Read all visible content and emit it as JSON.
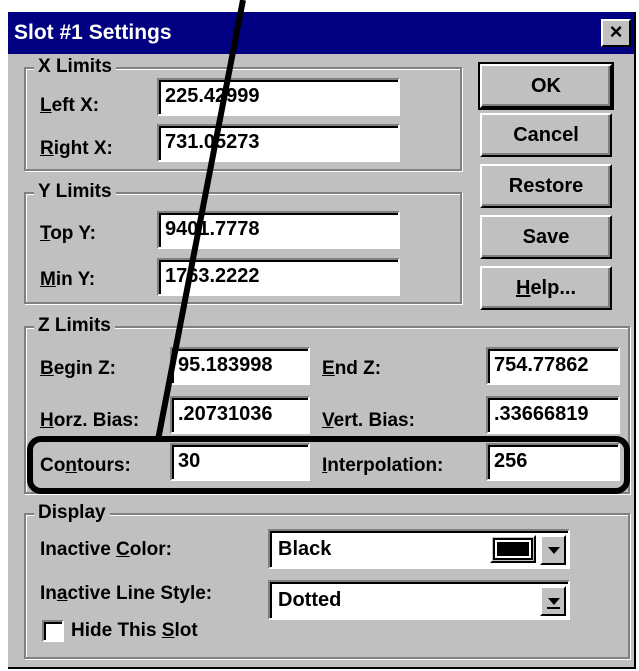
{
  "dialog": {
    "title": "Slot #1 Settings",
    "close_glyph": "×"
  },
  "x_limits": {
    "legend": "X Limits",
    "left_label_key": "L",
    "left_label_rest": "eft X:",
    "left_value": "225.42999",
    "right_label_key": "R",
    "right_label_rest": "ight X:",
    "right_value": "731.05273"
  },
  "y_limits": {
    "legend": "Y Limits",
    "top_label_key": "T",
    "top_label_rest": "op Y:",
    "top_value": "9401.7778",
    "min_label_key": "M",
    "min_label_rest": "in Y:",
    "min_value": "1763.2222"
  },
  "buttons": {
    "ok": "OK",
    "cancel": "Cancel",
    "restore": "Restore",
    "save": "Save",
    "help_key": "H",
    "help_rest": "elp..."
  },
  "z_limits": {
    "legend": "Z Limits",
    "begin_label_key": "B",
    "begin_label_rest": "egin Z:",
    "begin_value": "95.183998",
    "end_label_key": "E",
    "end_label_rest": "nd Z:",
    "end_value": "754.77862",
    "horz_label_key": "H",
    "horz_label_rest": "orz. Bias:",
    "horz_value": ".20731036",
    "vert_label_key": "V",
    "vert_label_rest": "ert. Bias:",
    "vert_value": ".33666819",
    "contours_label_pre": "Co",
    "contours_label_key": "n",
    "contours_label_rest": "tours:",
    "contours_value": "30",
    "interp_label_key": "I",
    "interp_label_rest": "nterpolation:",
    "interp_value": "256"
  },
  "display": {
    "legend": "Display",
    "inactive_color_pre": "Inactive ",
    "inactive_color_key": "C",
    "inactive_color_rest": "olor:",
    "inactive_color_value": "Black",
    "swatch_color": "#000000",
    "inactive_line_pre": "In",
    "inactive_line_key": "a",
    "inactive_line_rest": "ctive Line Style:",
    "inactive_line_value": "Dotted",
    "hide_pre": "Hide This ",
    "hide_key": "S",
    "hide_rest": "lot",
    "hide_checked": false
  },
  "colors": {
    "title_bar": "#000080",
    "dialog_face": "#c0c0c0"
  }
}
